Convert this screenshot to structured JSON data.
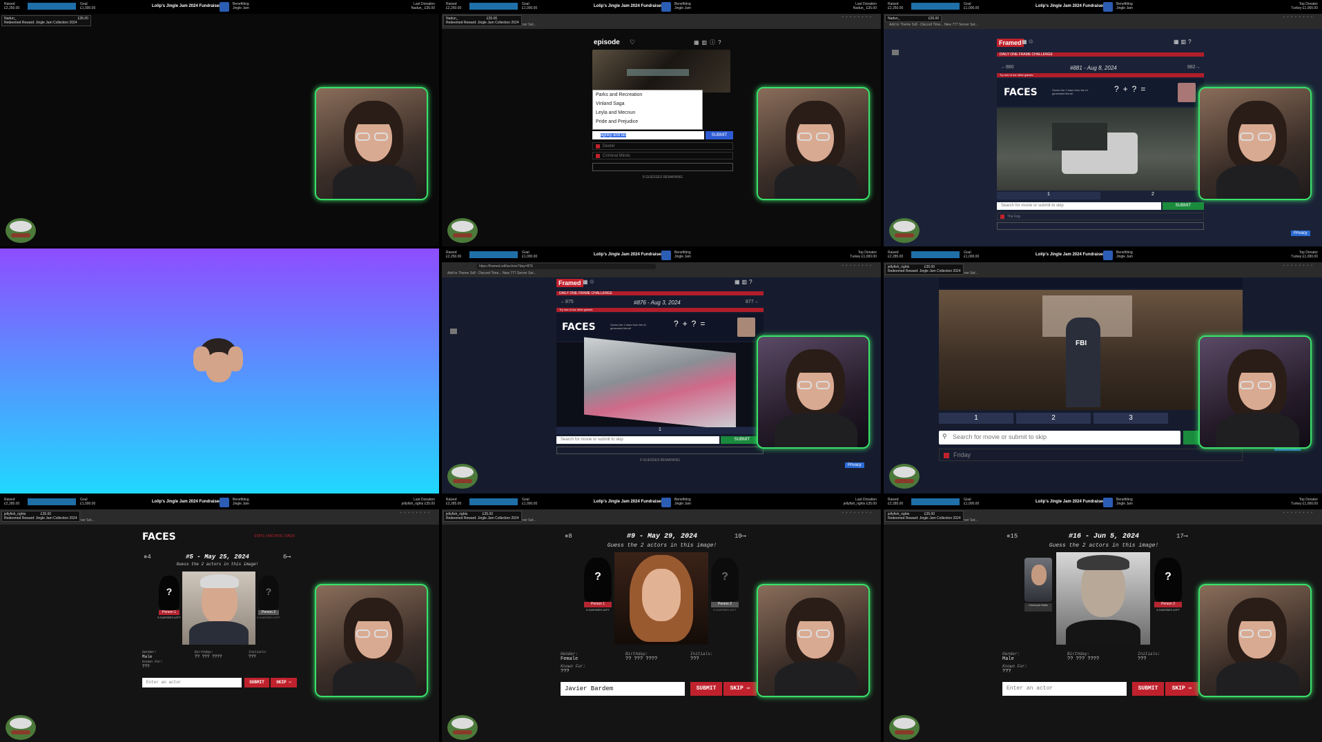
{
  "overlay": {
    "raised_label": "Raised",
    "raised_value": "£2,250.00",
    "raised_value_b": "£2,285.00",
    "goal_label": "Goal",
    "goal_value": "£1,000.00",
    "title": "Lolip's Jingle Jam 2024 Fundraiser!",
    "benefitting_label": "Benefitting",
    "benefitting_value": "Jingle Jam",
    "last_donation_label": "Last Donation",
    "last_donation_value": "Nadun_ £35.00",
    "top_donator_label": "Top Donator",
    "top_donator_value": "Turkey £1,000.00",
    "top_donator_value_b": "jellyfish_rights £35.00"
  },
  "notifications": {
    "nadun": "Nadun_",
    "jellyfish": "jellyfish_rights",
    "amount": "£35.00",
    "redeemed": "Redeemed Reward: Jingle Jam Collection 2024"
  },
  "browser": {
    "bookmarks": "Add to Theme   3v8 - Discord Time...   New 777 Server Set...",
    "other": "Other favourites",
    "url_framed": "https://framed.wtf/archive?day=876"
  },
  "episode_game": {
    "logo": "episode",
    "suggestions": [
      "Parks and Recreation",
      "Vinland Saga",
      "Leyla and Mecnun",
      "Pride and Prejudice"
    ],
    "input_value": "agney and lac",
    "submit": "SUBMIT",
    "guesses": [
      "Dexter",
      "Criminal Minds"
    ],
    "remaining": "8 GUESSES REMAINING"
  },
  "framed_881": {
    "logo": "Framed",
    "banner": "DAILY ONE FRAME CHALLENGE",
    "nav_prev": "←880",
    "title": "#881 - Aug 8, 2024",
    "nav_next": "882→",
    "promo": "Try one of our other games:",
    "faces": "FACES",
    "faces_sub": "Guess the 2 stars from the AI generated blend!",
    "tabs": [
      "1",
      "2"
    ],
    "search_placeholder": "Search for movie or submit to skip",
    "submit": "SUBMIT",
    "guess": "The Fog",
    "privacy": "Privacy"
  },
  "framed_876": {
    "logo": "Framed",
    "banner": "DAILY ONE FRAME CHALLENGE",
    "nav_prev": "←875",
    "title": "#876 - Aug 3, 2024",
    "nav_next": "877→",
    "promo": "Try one of our other games:",
    "faces": "FACES",
    "faces_sub": "Guess the 2 stars from the AI generated blend!",
    "tab": "1",
    "search_placeholder": "Search for movie or submit to skip",
    "submit": "SUBMIT",
    "remaining": "6 GUESSES REMAINING",
    "privacy": "Privacy"
  },
  "framed_zoom": {
    "tabs": [
      "1",
      "2",
      "3"
    ],
    "search_placeholder": "Search for movie or submit to skip",
    "submit": "SUBMIT",
    "guess": "Friday",
    "privacy": "Privacy",
    "sign": "FBI"
  },
  "faces_5": {
    "logo": "FACES",
    "links": "STATS | ARCHIVE | FAQS",
    "nav_prev": "✵4",
    "nav_next": "6⟶",
    "title": "#5 - May 25, 2024",
    "prompt": "Guess the 2 actors in this image!",
    "person1": "Person 1",
    "person2": "Person 2",
    "guesses_left": "5 GUESSES LEFT",
    "gender_label": "Gender:",
    "gender": "Male",
    "birthday_label": "Birthday:",
    "birthday": "?? ??? ????",
    "initials_label": "Initials:",
    "initials": "???",
    "known_label": "Known For:",
    "known": "???",
    "input_placeholder": "Enter an actor",
    "submit": "SUBMIT",
    "skip": "SKIP ⇨"
  },
  "faces_9": {
    "nav_prev": "✵8",
    "nav_next": "10⟶",
    "title": "#9 - May 29, 2024",
    "prompt": "Guess the 2 actors in this image!",
    "person1": "Person 1",
    "person2": "Person 2",
    "guesses_left": "5 GUESSES LEFT",
    "gender_label": "Gender:",
    "gender": "Female",
    "birthday_label": "Birthday:",
    "birthday": "?? ??? ????",
    "initials_label": "Initials:",
    "initials": "???",
    "known_label": "Known For:",
    "known": "???",
    "input_value": "Javier Bardem",
    "submit": "SUBMIT",
    "skip": "SKIP ⇨"
  },
  "faces_16": {
    "nav_prev": "✵15",
    "nav_next": "17⟶",
    "title": "#16 - Jun 5, 2024",
    "prompt": "Guess the 2 actors in this image!",
    "found_name": "Christoph Waltz",
    "person2": "Person 2",
    "guesses_left": "4 GUESSES LEFT",
    "gender_label": "Gender:",
    "gender": "Male",
    "birthday_label": "Birthday:",
    "birthday": "?? ??? ????",
    "initials_label": "Initials:",
    "initials": "???",
    "known_label": "Known For:",
    "known": "???",
    "input_placeholder": "Enter an actor",
    "submit": "SUBMIT",
    "skip": "SKIP ⇨"
  },
  "colors": {
    "accent_red": "#c0222d",
    "webcam_border": "#3be06b",
    "submit_blue": "#2e5bd4",
    "gradient_top": "#8e4dff",
    "gradient_bottom": "#20d8ff"
  }
}
